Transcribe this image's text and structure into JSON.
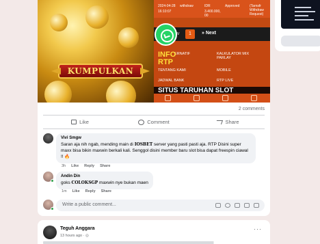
{
  "post": {
    "image": {
      "cta_label": "KUMPULKAN",
      "table_row_1": [
        "2024-04-28",
        "16:10:07",
        "withdraw",
        "IDR",
        "3.400.000,",
        "00",
        "Approved",
        "(Tarnsfr",
        "Withdraw",
        "Request)"
      ],
      "table_row_2": [
        "2024-04-28",
        "16:19:57",
        "withdraw",
        "IDR",
        "2.400.000,",
        "00",
        "Approved",
        "(Tarnsfr",
        "Withdraw",
        "Request)"
      ],
      "pager_prev": "ev",
      "pager_current": "1",
      "pager_next": "» Next",
      "info_label": "INFO",
      "rtp_label": "RTP",
      "menu_items": [
        "ERNATIF",
        "KALKULATOR MIX PARLAY",
        "TENTANG KAMI",
        "MOBILE",
        "JADWAL BANK",
        "RTP LIVE"
      ],
      "banner_text": "SITUS TARUHAN SLOT"
    },
    "comments_count": "2 comments",
    "actions": {
      "like": "Like",
      "comment": "Comment",
      "share": "Share"
    },
    "comments": [
      {
        "name": "Vivi Smgw",
        "text_before": "Saran aja nih ngab, mending main di ",
        "brand": "IOSBET",
        "text_after": " server yang pasti pasti aja. RTP Disini super maxx bisa bikin maxwin berkali kali. Senggol disini member baru slot bisa dapat freespin ciawal !! ",
        "emoji": "🔥",
        "time": "3h",
        "like": "Like",
        "reply": "Reply",
        "share": "Share"
      },
      {
        "name": "Andin Din",
        "text_before": "goks ",
        "brand": "COLOKSGP",
        "text_after": " maxwin nye bukan maen",
        "time": "1m",
        "like": "Like",
        "reply": "Reply",
        "share": "Share"
      }
    ],
    "composer_placeholder": "Write a public comment..."
  },
  "post2": {
    "author": "Teguh Anggara",
    "time": "13 hours ago · ",
    "more": "···"
  },
  "colors": {
    "accent_orange": "#d9531b",
    "whatsapp_green": "#25d366",
    "facebook_gray": "#65676b"
  }
}
